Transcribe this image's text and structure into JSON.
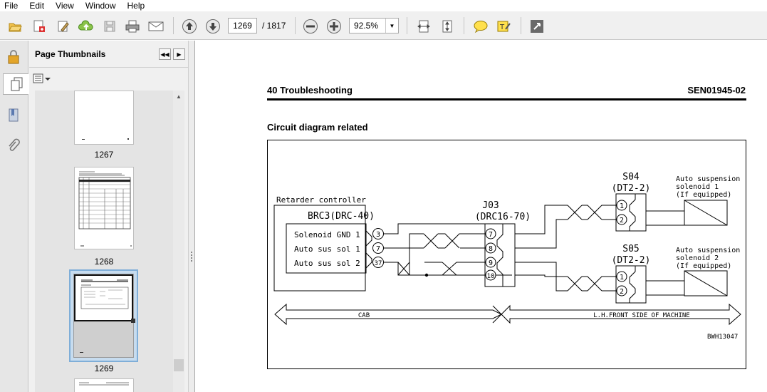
{
  "menu": [
    "File",
    "Edit",
    "View",
    "Window",
    "Help"
  ],
  "toolbar": {
    "page_current": "1269",
    "page_total": "/ 1817",
    "zoom": "92.5%",
    "icons": [
      "open-icon",
      "create-pdf-icon",
      "edit-icon",
      "upload-icon",
      "save-icon",
      "print-icon",
      "email-icon",
      "previous-page-icon",
      "next-page-icon",
      "zoom-out-icon",
      "zoom-in-icon",
      "fit-width-icon",
      "fit-page-icon",
      "comment-icon",
      "highlight-icon",
      "expand-icon"
    ]
  },
  "thumbnails": {
    "title": "Page Thumbnails",
    "pages": [
      {
        "label": "1267"
      },
      {
        "label": "1268"
      },
      {
        "label": "1269",
        "selected": true
      }
    ]
  },
  "document": {
    "section": "40 Troubleshooting",
    "doc_code": "SEN01945-02",
    "subtitle": "Circuit diagram related",
    "diagram": {
      "controller_label": "Retarder controller",
      "controller_connector": "BRC3(DRC-40)",
      "controller_pins": [
        {
          "name": "Solenoid GND 1",
          "pin": "3"
        },
        {
          "name": "Auto sus sol 1",
          "pin": "7"
        },
        {
          "name": "Auto sus sol 2",
          "pin": "37"
        }
      ],
      "junction_label": "J03",
      "junction_connector": "(DRC16-70)",
      "junction_pins": [
        "7",
        "8",
        "9",
        "10"
      ],
      "s04_label": "S04",
      "s04_connector": "(DT2-2)",
      "s05_label": "S05",
      "s05_connector": "(DT2-2)",
      "solenoid_pins": [
        "1",
        "2"
      ],
      "solenoid1": [
        "Auto suspension",
        "solenoid 1",
        "(If equipped)"
      ],
      "solenoid2": [
        "Auto suspension",
        "solenoid 2",
        "(If equipped)"
      ],
      "zone_left": "CAB",
      "zone_right": "L.H.FRONT SIDE OF MACHINE",
      "figure_code": "BWH13047"
    }
  }
}
